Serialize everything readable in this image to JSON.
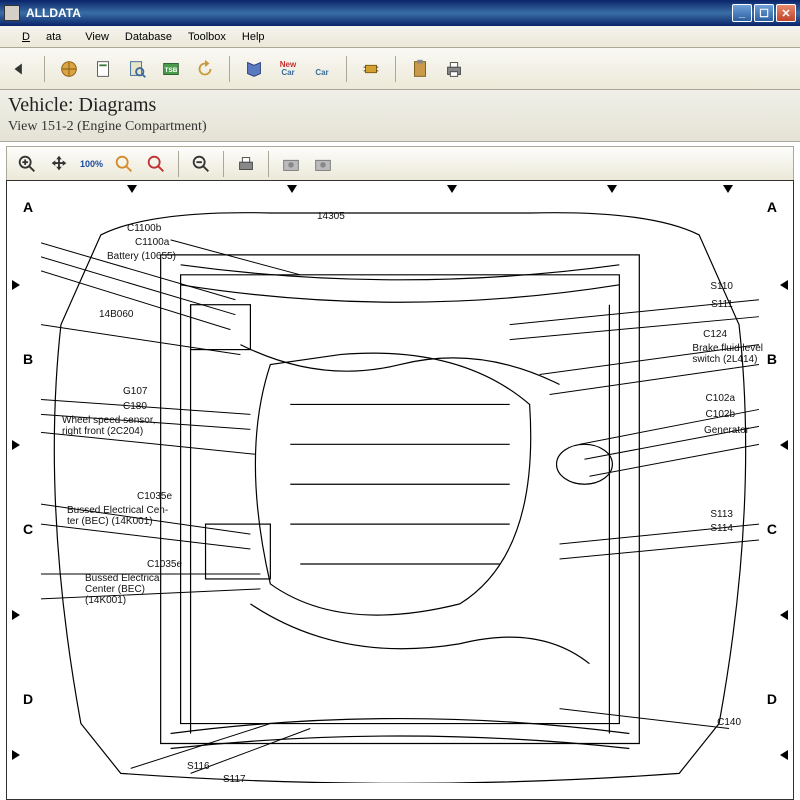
{
  "window": {
    "title": "ALLDATA"
  },
  "menu": {
    "data": "Data",
    "view": "View",
    "database": "Database",
    "toolbox": "Toolbox",
    "help": "Help"
  },
  "zoom": {
    "percent": "100%"
  },
  "header": {
    "title": "Vehicle:  Diagrams",
    "subtitle": "View 151-2 (Engine Compartment)"
  },
  "axes": {
    "a": "A",
    "b": "B",
    "c": "C",
    "d": "D"
  },
  "labels": {
    "left": [
      "C1100b",
      "C1100a",
      "Battery (10655)",
      "14305",
      "14B060",
      "G107",
      "C180",
      "Wheel speed sensor,\nright front (2C204)",
      "C1035e",
      "Bussed Electrical Cen-\nter (BEC) (14K001)",
      "C1035e",
      "Bussed Electrical\nCenter (BEC)\n(14K001)",
      "S116",
      "S117"
    ],
    "right": [
      "S110",
      "S111",
      "C124",
      "Brake fluid level\nswitch (2L414)",
      "C102a",
      "C102b",
      "Generator",
      "S113",
      "S114",
      "C140"
    ]
  }
}
